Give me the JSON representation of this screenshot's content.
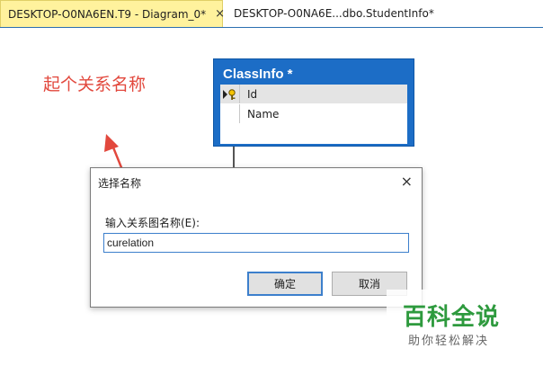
{
  "tabs": [
    {
      "label": "DESKTOP-O0NA6EN.T9 - Diagram_0*",
      "close_symbol": "×"
    },
    {
      "label": "DESKTOP-O0NA6E...dbo.StudentInfo*"
    }
  ],
  "diagram": {
    "table": {
      "title": "ClassInfo *",
      "columns": [
        {
          "name": "Id",
          "primary_key": true
        },
        {
          "name": "Name",
          "primary_key": false
        }
      ]
    }
  },
  "annotation": {
    "text": "起个关系名称",
    "color": "#e2483d"
  },
  "dialog": {
    "title": "选择名称",
    "close_symbol": "×",
    "label": "输入关系图名称(E):",
    "input_value": "curelation",
    "ok_label": "确定",
    "cancel_label": "取消"
  },
  "watermark": {
    "main": "百科全说",
    "sub": "助你轻松解决"
  },
  "colors": {
    "table_header": "#1c6dc6",
    "active_tab": "#fff29d",
    "focus_border": "#3c7fcc",
    "watermark_green": "#2e9a3e"
  }
}
